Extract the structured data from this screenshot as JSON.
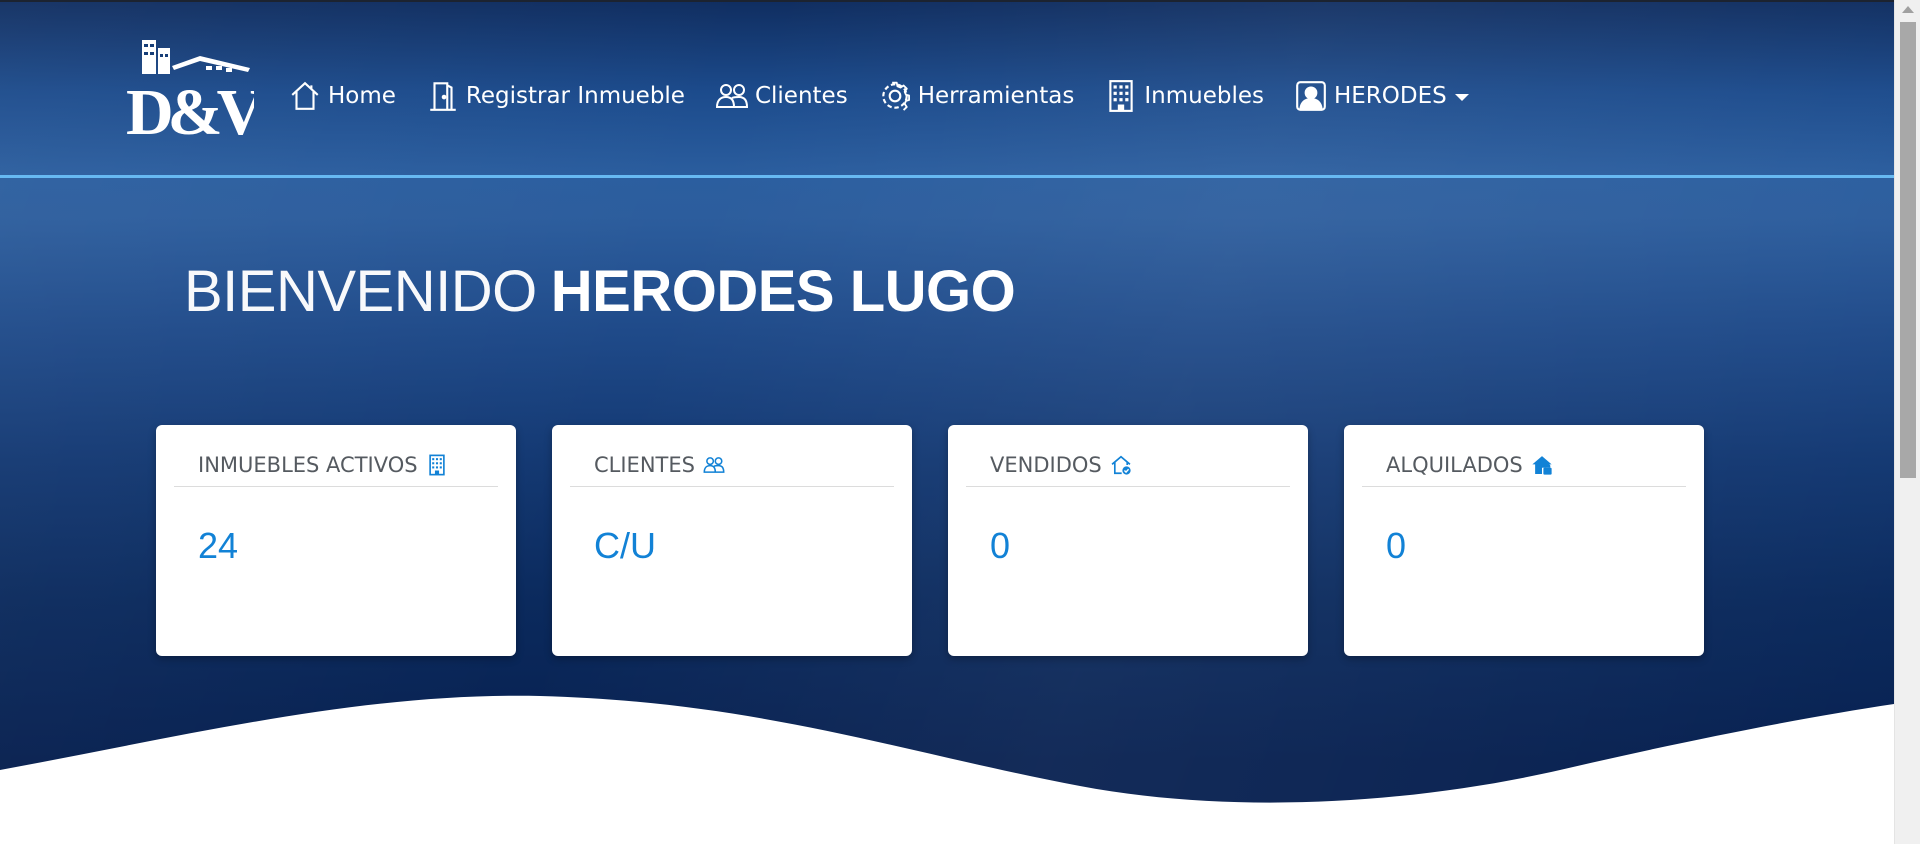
{
  "brand": {
    "logo_text": "D&V",
    "accent": "#1282d6",
    "nav_underline": "#67b9f2"
  },
  "nav": {
    "items": [
      {
        "label": "Home",
        "icon": "house-icon"
      },
      {
        "label": "Registrar Inmueble",
        "icon": "door-icon"
      },
      {
        "label": "Clientes",
        "icon": "people-icon"
      },
      {
        "label": "Herramientas",
        "icon": "gear-icon"
      },
      {
        "label": "Inmuebles",
        "icon": "building-icon"
      },
      {
        "label": "HERODES",
        "icon": "person-badge-icon",
        "dropdown": true
      }
    ]
  },
  "welcome": {
    "prefix": "BIENVENIDO",
    "name": "HERODES LUGO"
  },
  "cards": [
    {
      "title": "INMUEBLES ACTIVOS",
      "icon": "building-icon",
      "value": "24"
    },
    {
      "title": "CLIENTES",
      "icon": "people-icon",
      "value": "C/U"
    },
    {
      "title": "VENDIDOS",
      "icon": "house-check-icon",
      "value": "0"
    },
    {
      "title": "ALQUILADOS",
      "icon": "house-lock-icon",
      "value": "0"
    }
  ]
}
